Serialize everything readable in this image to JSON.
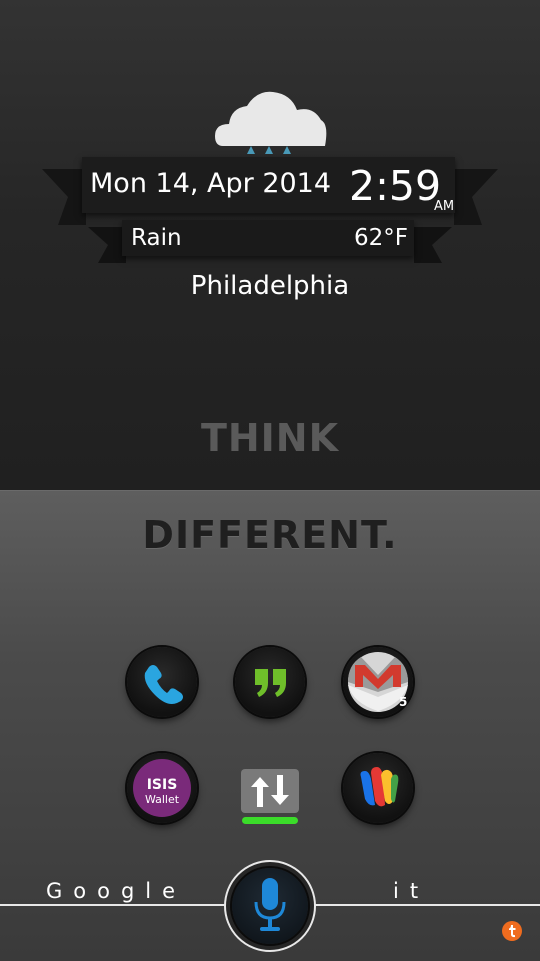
{
  "widget": {
    "date": "Mon 14, Apr 2014",
    "time": "2:59",
    "ampm": "AM",
    "condition": "Rain",
    "temperature": "62°F",
    "city": "Philadelphia",
    "weather_icon": "rain-cloud-icon"
  },
  "slogan": {
    "line1": "THINK",
    "line2": "DIFFERENT."
  },
  "apps": [
    {
      "name": "phone",
      "icon": "phone-icon"
    },
    {
      "name": "hangouts",
      "icon": "quote-icon"
    },
    {
      "name": "gmail",
      "icon": "gmail-icon",
      "badge": "5"
    },
    {
      "name": "isis-wallet",
      "icon": "isis-wallet-icon",
      "label_top": "ISIS",
      "label_bottom": "Wallet"
    },
    {
      "name": "data-toggle",
      "icon": "data-arrows-icon"
    },
    {
      "name": "google-wallet",
      "icon": "google-wallet-icon"
    }
  ],
  "search": {
    "left": "Google",
    "right": "it",
    "icon": "microphone-icon"
  },
  "colors": {
    "phone_blue": "#2aa5e0",
    "hangouts_green": "#6fbf2a",
    "gmail_red": "#d23a2e",
    "indicator_green": "#3bdc2a",
    "mic_blue": "#1e88d8"
  }
}
